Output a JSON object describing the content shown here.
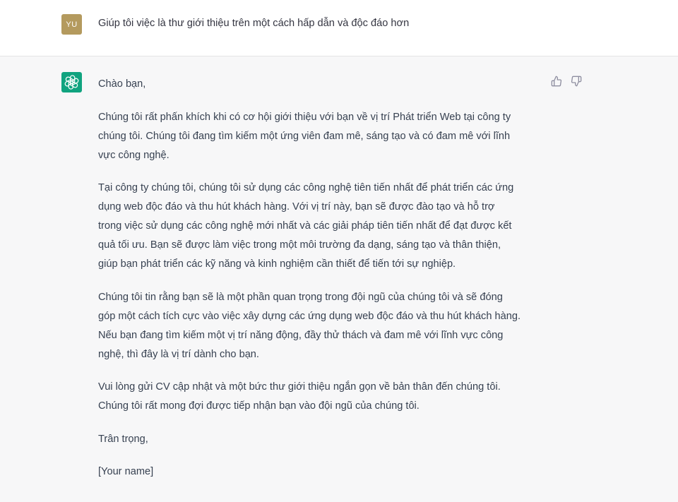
{
  "user": {
    "avatar_initials": "YU",
    "message": "Giúp tôi việc là thư giới thiệu trên một cách hấp dẫn và độc đáo hơn"
  },
  "assistant": {
    "icon": "openai-logo-icon",
    "lines": [
      "Chào bạn,",
      "Chúng tôi rất phấn khích khi có cơ hội giới thiệu với bạn về vị trí Phát triển Web tại công ty",
      "chúng tôi. Chúng tôi đang tìm kiếm một ứng viên đam mê, sáng tạo và có đam mê với lĩnh",
      "vực công nghệ.",
      "Tại công ty chúng tôi, chúng tôi sử dụng các công nghệ tiên tiến nhất để phát triển các ứng",
      "dụng web độc đáo và thu hút khách hàng. Với vị trí này, bạn sẽ được đào tạo và hỗ trợ",
      "trong việc sử dụng các công nghệ mới nhất và các giải pháp tiên tiến nhất để đạt được kết",
      "quả tối ưu. Bạn sẽ được làm việc trong một môi trường đa dạng, sáng tạo và thân thiện,",
      "giúp bạn phát triển các kỹ năng và kinh nghiệm cần thiết để tiến tới sự nghiệp.",
      "Chúng tôi tin rằng bạn sẽ là một phần quan trọng trong đội ngũ của chúng tôi và sẽ đóng",
      "góp một cách tích cực vào việc xây dựng các ứng dụng web độc đáo và thu hút khách hàng.",
      "Nếu bạn đang tìm kiếm một vị trí năng động, đầy thử thách và đam mê với lĩnh vực công",
      "nghệ, thì đây là vị trí dành cho bạn.",
      "Vui lòng gửi CV cập nhật và một bức thư giới thiệu ngắn gọn về bản thân đến chúng tôi.",
      "Chúng tôi rất mong đợi được tiếp nhận bạn vào đội ngũ của chúng tôi.",
      "Trân trọng,",
      "[Your name]"
    ]
  },
  "feedback": {
    "thumbs_up_icon": "thumbs-up-icon",
    "thumbs_down_icon": "thumbs-down-icon"
  },
  "colors": {
    "user_avatar": "#b49a5e",
    "assistant_avatar": "#10a37f",
    "assistant_bg": "#f7f7f8"
  }
}
